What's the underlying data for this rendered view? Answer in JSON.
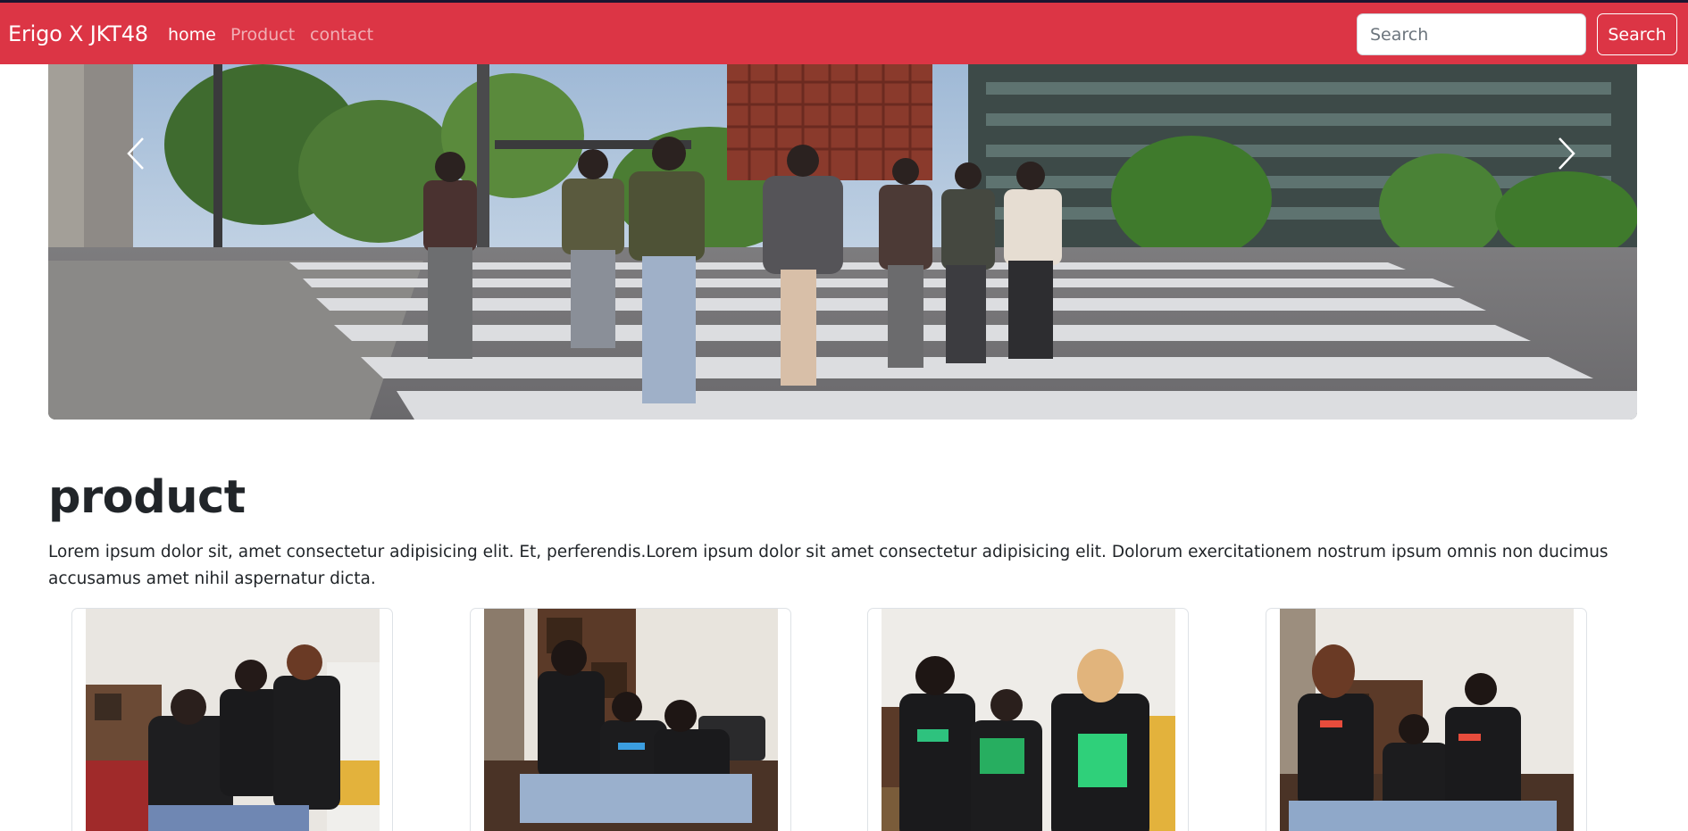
{
  "navbar": {
    "brand": "Erigo X JKT48",
    "links": [
      {
        "label": "home",
        "active": true
      },
      {
        "label": "Product",
        "active": false
      },
      {
        "label": "contact",
        "active": false
      }
    ],
    "search": {
      "placeholder": "Search",
      "value": "",
      "button_label": "Search"
    },
    "background_color": "#dc3545"
  },
  "carousel": {
    "prev_icon": "chevron-left-icon",
    "next_icon": "chevron-right-icon"
  },
  "product_section": {
    "title": "product",
    "description": "Lorem ipsum dolor sit, amet consectetur adipisicing elit. Et, perferendis.Lorem ipsum dolor sit amet consectetur adipisicing elit. Dolorum exercitationem nostrum ipsum omnis non ducimus accusamus amet nihil aspernatur dicta."
  }
}
